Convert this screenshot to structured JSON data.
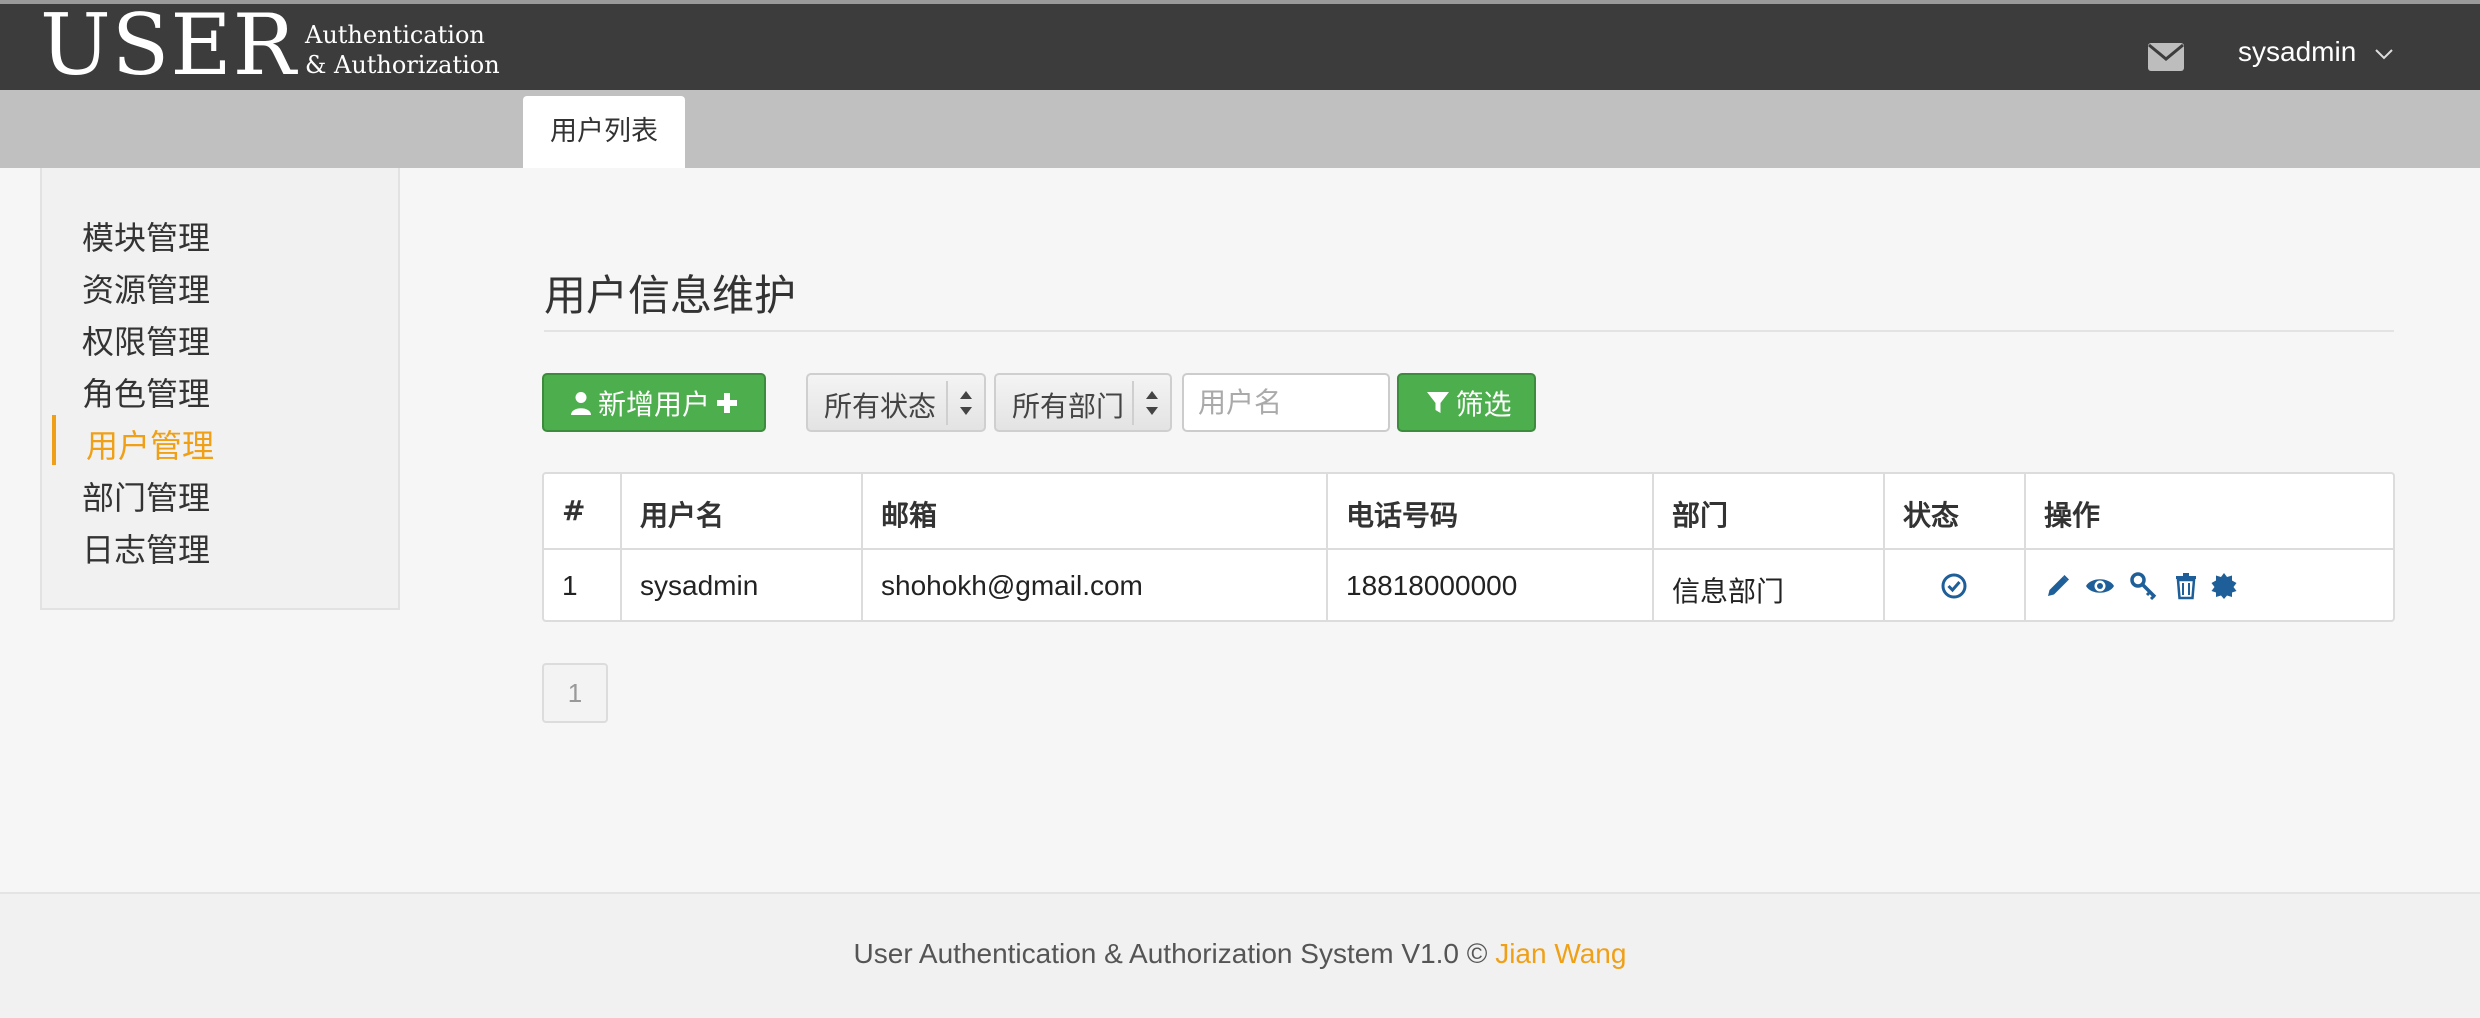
{
  "brand": {
    "big": "USER",
    "line1": "Authentication",
    "line2": "& Authorization"
  },
  "header": {
    "username": "sysadmin",
    "mail_icon": "envelope-icon",
    "caret_icon": "chevron-down-icon"
  },
  "tabs": [
    {
      "label": "用户列表",
      "active": true
    }
  ],
  "sidebar": {
    "items": [
      {
        "label": "模块管理"
      },
      {
        "label": "资源管理"
      },
      {
        "label": "权限管理"
      },
      {
        "label": "角色管理"
      },
      {
        "label": "用户管理",
        "active": true
      },
      {
        "label": "部门管理"
      },
      {
        "label": "日志管理"
      }
    ]
  },
  "main": {
    "title": "用户信息维护",
    "toolbar": {
      "add_label": "新增用户",
      "status_select": "所有状态",
      "dept_select": "所有部门",
      "username_placeholder": "用户名",
      "filter_label": "筛选"
    },
    "table": {
      "headers": [
        "#",
        "用户名",
        "邮箱",
        "电话号码",
        "部门",
        "状态",
        "操作"
      ],
      "rows": [
        {
          "index": "1",
          "username": "sysadmin",
          "email": "shohokh@gmail.com",
          "phone": "18818000000",
          "department": "信息部门",
          "status_icon": "check-circle-icon",
          "actions": [
            "pencil-icon",
            "eye-icon",
            "key-icon",
            "trash-icon",
            "certificate-icon"
          ]
        }
      ]
    },
    "pagination": {
      "current": "1"
    }
  },
  "footer": {
    "text": "User Authentication & Authorization System V1.0 © ",
    "author": "Jian Wang"
  },
  "colors": {
    "nav_bg": "#3c3c3c",
    "tab_strip": "#c0c0c0",
    "accent_orange": "#f0a017",
    "button_green": "#4cae4c",
    "icon_blue": "#1f5f99"
  }
}
